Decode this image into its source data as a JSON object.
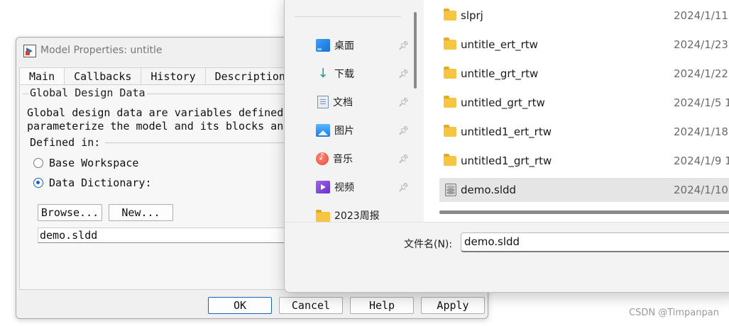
{
  "model_properties": {
    "title": "Model Properties: untitle",
    "tabs": [
      "Main",
      "Callbacks",
      "History",
      "Description"
    ],
    "group_title": "Global Design Data",
    "description": "Global design data are variables defined\nparameterize the model and its blocks and",
    "defined_in_label": "Defined in:",
    "radio_base_workspace": "Base Workspace",
    "radio_data_dictionary": "Data Dictionary:",
    "selected_option": "Data Dictionary:",
    "browse_button": "Browse...",
    "new_button": "New...",
    "dictionary_value": "demo.sldd",
    "buttons": {
      "ok": "OK",
      "cancel": "Cancel",
      "help": "Help",
      "apply": "Apply"
    }
  },
  "file_dialog": {
    "nav_items": [
      {
        "label": "桌面",
        "icon": "desktop-icon",
        "pinned": true
      },
      {
        "label": "下载",
        "icon": "download-icon",
        "pinned": true
      },
      {
        "label": "文档",
        "icon": "documents-icon",
        "pinned": true
      },
      {
        "label": "图片",
        "icon": "pictures-icon",
        "pinned": true
      },
      {
        "label": "音乐",
        "icon": "music-icon",
        "pinned": true
      },
      {
        "label": "视频",
        "icon": "videos-icon",
        "pinned": true
      },
      {
        "label": "2023周报",
        "icon": "folder-icon",
        "pinned": false
      }
    ],
    "files": [
      {
        "name": "slprj",
        "date": "2024/1/11",
        "type": "folder",
        "selected": false
      },
      {
        "name": "untitle_ert_rtw",
        "date": "2024/1/23",
        "type": "folder",
        "selected": false
      },
      {
        "name": "untitle_grt_rtw",
        "date": "2024/1/22",
        "type": "folder",
        "selected": false
      },
      {
        "name": "untitled_grt_rtw",
        "date": "2024/1/5 1",
        "type": "folder",
        "selected": false
      },
      {
        "name": "untitled1_ert_rtw",
        "date": "2024/1/18",
        "type": "folder",
        "selected": false
      },
      {
        "name": "untitled1_grt_rtw",
        "date": "2024/1/9 1",
        "type": "folder",
        "selected": false
      },
      {
        "name": "demo.sldd",
        "date": "2024/1/10",
        "type": "sldd",
        "selected": true
      }
    ],
    "file_name_label": "文件名(N):",
    "file_name_value": "demo.sldd"
  },
  "watermark": "CSDN @Timpanpan"
}
